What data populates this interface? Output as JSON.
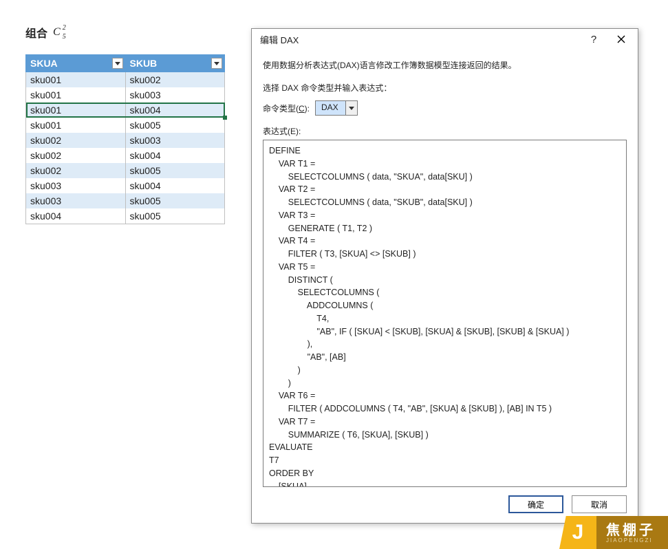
{
  "heading": "组合",
  "formula": {
    "c": "C",
    "sup": "2",
    "sub": "5"
  },
  "table": {
    "headers": [
      "SKUA",
      "SKUB"
    ],
    "rows": [
      [
        "sku001",
        "sku002"
      ],
      [
        "sku001",
        "sku003"
      ],
      [
        "sku001",
        "sku004"
      ],
      [
        "sku001",
        "sku005"
      ],
      [
        "sku002",
        "sku003"
      ],
      [
        "sku002",
        "sku004"
      ],
      [
        "sku002",
        "sku005"
      ],
      [
        "sku003",
        "sku004"
      ],
      [
        "sku003",
        "sku005"
      ],
      [
        "sku004",
        "sku005"
      ]
    ],
    "selected_row_index": 2
  },
  "dialog": {
    "title": "编辑 DAX",
    "desc": "使用数据分析表达式(DAX)语言修改工作簿数据模型连接返回的结果。",
    "select_cmd_label": "选择 DAX 命令类型并输入表达式：",
    "cmd_type_label_pre": "命令类型(",
    "cmd_type_label_u": "C",
    "cmd_type_label_post": "):",
    "cmd_type_value": "DAX",
    "expr_label_pre": "表达式(",
    "expr_label_u": "E",
    "expr_label_post": "):",
    "expression": "DEFINE\n    VAR T1 =\n        SELECTCOLUMNS ( data, \"SKUA\", data[SKU] )\n    VAR T2 =\n        SELECTCOLUMNS ( data, \"SKUB\", data[SKU] )\n    VAR T3 =\n        GENERATE ( T1, T2 )\n    VAR T4 =\n        FILTER ( T3, [SKUA] <> [SKUB] )\n    VAR T5 =\n        DISTINCT (\n            SELECTCOLUMNS (\n                ADDCOLUMNS (\n                    T4,\n                    \"AB\", IF ( [SKUA] < [SKUB], [SKUA] & [SKUB], [SKUB] & [SKUA] )\n                ),\n                \"AB\", [AB]\n            )\n        )\n    VAR T6 =\n        FILTER ( ADDCOLUMNS ( T4, \"AB\", [SKUA] & [SKUB] ), [AB] IN T5 )\n    VAR T7 =\n        SUMMARIZE ( T6, [SKUA], [SKUB] )\nEVALUATE\nT7\nORDER BY\n    [SKUA],\n    [SKUB] ASC",
    "ok": "确定",
    "cancel": "取消",
    "help": "?"
  },
  "watermark": {
    "j": "J",
    "name": "焦棚子",
    "py": "JIAOPENGZI"
  }
}
